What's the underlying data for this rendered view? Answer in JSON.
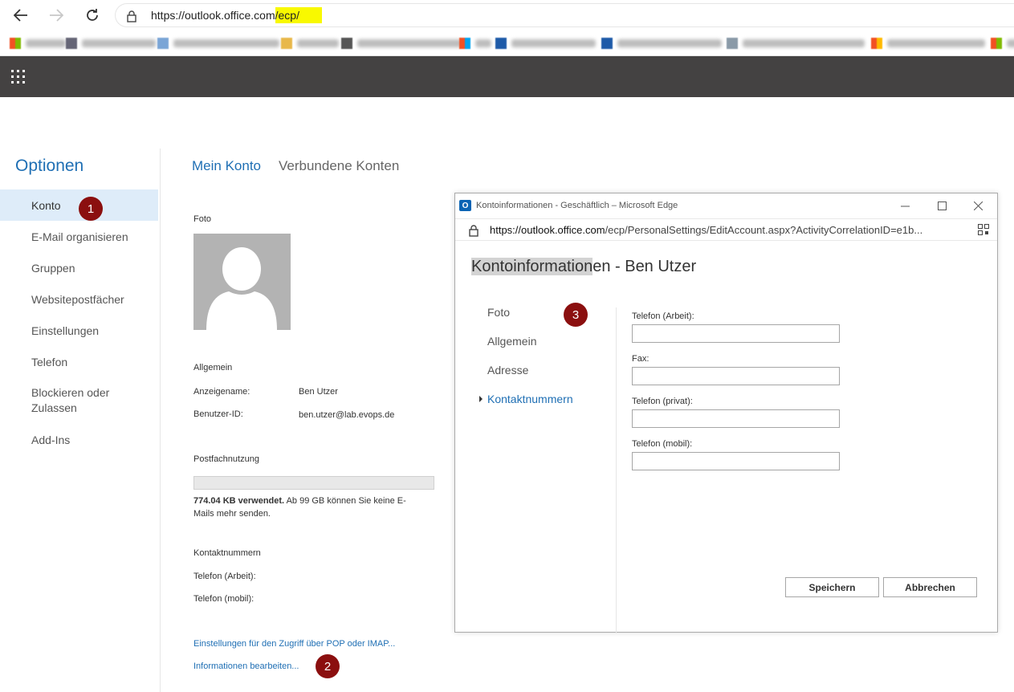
{
  "browser": {
    "url_prefix": "https://outlook.office.com",
    "url_highlight": "/ecp/"
  },
  "nav": {
    "title": "Optionen",
    "items": [
      {
        "label": "Konto",
        "active": true
      },
      {
        "label": "E-Mail organisieren"
      },
      {
        "label": "Gruppen"
      },
      {
        "label": "Websitepostfächer"
      },
      {
        "label": "Einstellungen"
      },
      {
        "label": "Telefon"
      },
      {
        "label": "Blockieren oder Zulassen"
      },
      {
        "label": "Add-Ins"
      }
    ]
  },
  "tabs": {
    "active": "Mein Konto",
    "inactive": "Verbundene Konten"
  },
  "account": {
    "photo_label": "Foto",
    "general_heading": "Allgemein",
    "display_name_label": "Anzeigename:",
    "display_name_value": "Ben Utzer",
    "user_id_label": "Benutzer-ID:",
    "user_id_value": "ben.utzer@lab.evops.de",
    "mailbox_heading": "Postfachnutzung",
    "storage_used": "774.04 KB verwendet.",
    "storage_note": " Ab 99 GB können Sie keine E-Mails mehr senden.",
    "contact_heading": "Kontaktnummern",
    "phone_work_label": "Telefon (Arbeit):",
    "phone_mobile_label": "Telefon (mobil):",
    "pop_imap_link": "Einstellungen für den Zugriff über POP oder IMAP...",
    "edit_info_link": "Informationen bearbeiten..."
  },
  "badges": {
    "one": "1",
    "two": "2",
    "three": "3"
  },
  "popup": {
    "window_title": "Kontoinformationen - Geschäftlich – Microsoft Edge",
    "url_domain": "https://outlook.office.com",
    "url_rest": "/ecp/PersonalSettings/EditAccount.aspx?ActivityCorrelationID=e1b...",
    "heading_selected": "Kontoinformation",
    "heading_rest": "en - Ben Utzer",
    "nav": [
      {
        "label": "Foto"
      },
      {
        "label": "Allgemein"
      },
      {
        "label": "Adresse"
      },
      {
        "label": "Kontaktnummern",
        "active": true
      }
    ],
    "fields": {
      "work": {
        "label": "Telefon (Arbeit):",
        "value": ""
      },
      "fax": {
        "label": "Fax:",
        "value": ""
      },
      "private": {
        "label": "Telefon (privat):",
        "value": ""
      },
      "mobile": {
        "label": "Telefon (mobil):",
        "value": ""
      }
    },
    "save_label": "Speichern",
    "cancel_label": "Abbrechen"
  },
  "colors": {
    "accent": "#1f6fb4",
    "app_bar": "#444242",
    "badge": "#8b0f0f",
    "url_highlight": "#f9f900",
    "nav_active_bg": "#deecf9"
  }
}
